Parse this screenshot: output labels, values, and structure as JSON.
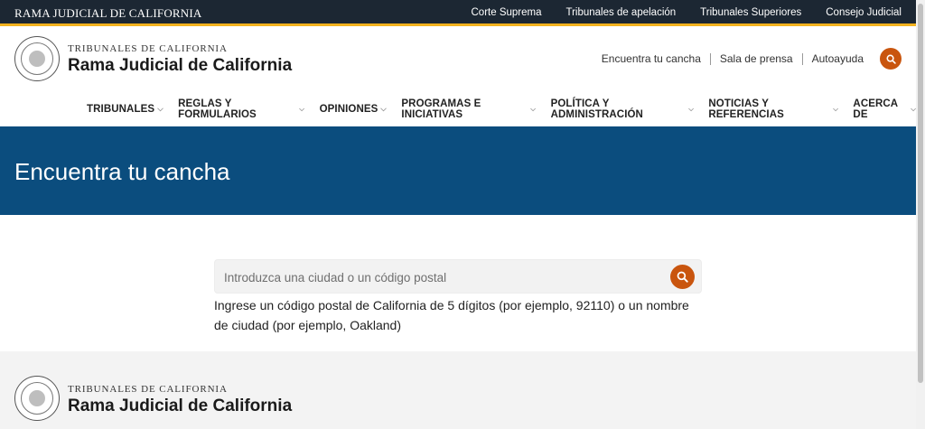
{
  "topbar": {
    "brand": "RAMA JUDICIAL DE CALIFORNIA",
    "links": [
      "Corte Suprema",
      "Tribunales de apelación",
      "Tribunales Superiores",
      "Consejo Judicial"
    ]
  },
  "header": {
    "subtitle": "TRIBUNALES DE CALIFORNIA",
    "title": "Rama Judicial de California",
    "utility_links": [
      "Encuentra tu cancha",
      "Sala de prensa",
      "Autoayuda"
    ],
    "search_icon": "search-icon"
  },
  "nav": {
    "items": [
      "TRIBUNALES",
      "REGLAS Y FORMULARIOS",
      "OPINIONES",
      "PROGRAMAS E INICIATIVAS",
      "POLÍTICA Y ADMINISTRACIÓN",
      "NOTICIAS Y REFERENCIAS",
      "ACERCA DE"
    ]
  },
  "hero": {
    "title": "Encuentra tu cancha"
  },
  "search": {
    "placeholder": "Introduzca una ciudad o un código postal",
    "value": "",
    "help": "Ingrese un código postal de California de 5 dígitos (por ejemplo, 92110) o un nombre de ciudad (por ejemplo, Oakland)"
  },
  "footer": {
    "subtitle": "TRIBUNALES DE CALIFORNIA",
    "title": "Rama Judicial de California"
  },
  "colors": {
    "topbar": "#1c2733",
    "topbar_accent": "#f2b21e",
    "hero": "#0b4d7e",
    "accent_button": "#c9550e",
    "footer": "#f3f3f3"
  }
}
